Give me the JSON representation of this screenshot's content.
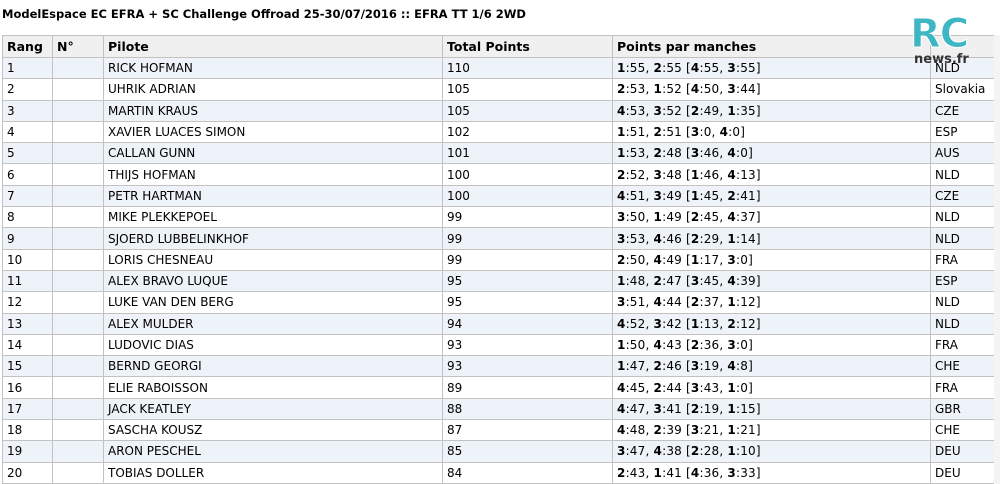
{
  "title": "ModelEspace EC EFRA + SC Challenge Offroad 25-30/07/2016 :: EFRA TT 1/6 2WD",
  "logo": {
    "main": "RC",
    "sub": "news.fr"
  },
  "headers": {
    "rang": "Rang",
    "num": "N°",
    "pilote": "Pilote",
    "total": "Total Points",
    "manches": "Points par manches",
    "country": ""
  },
  "rows": [
    {
      "rang": "1",
      "num": "",
      "pilote": "RICK HOFMAN",
      "total": "110",
      "manches": [
        "1:55",
        "2:55",
        "4:55",
        "3:55"
      ],
      "country": "NLD"
    },
    {
      "rang": "2",
      "num": "",
      "pilote": "UHRIK ADRIAN",
      "total": "105",
      "manches": [
        "2:53",
        "1:52",
        "4:50",
        "3:44"
      ],
      "country": "Slovakia"
    },
    {
      "rang": "3",
      "num": "",
      "pilote": "MARTIN KRAUS",
      "total": "105",
      "manches": [
        "4:53",
        "3:52",
        "2:49",
        "1:35"
      ],
      "country": "CZE"
    },
    {
      "rang": "4",
      "num": "",
      "pilote": "XAVIER LUACES SIMON",
      "total": "102",
      "manches": [
        "1:51",
        "2:51",
        "3:0",
        "4:0"
      ],
      "country": "ESP"
    },
    {
      "rang": "5",
      "num": "",
      "pilote": "CALLAN GUNN",
      "total": "101",
      "manches": [
        "1:53",
        "2:48",
        "3:46",
        "4:0"
      ],
      "country": "AUS"
    },
    {
      "rang": "6",
      "num": "",
      "pilote": "THIJS HOFMAN",
      "total": "100",
      "manches": [
        "2:52",
        "3:48",
        "1:46",
        "4:13"
      ],
      "country": "NLD"
    },
    {
      "rang": "7",
      "num": "",
      "pilote": "PETR HARTMAN",
      "total": "100",
      "manches": [
        "4:51",
        "3:49",
        "1:45",
        "2:41"
      ],
      "country": "CZE"
    },
    {
      "rang": "8",
      "num": "",
      "pilote": "MIKE PLEKKEPOEL",
      "total": "99",
      "manches": [
        "3:50",
        "1:49",
        "2:45",
        "4:37"
      ],
      "country": "NLD"
    },
    {
      "rang": "9",
      "num": "",
      "pilote": "SJOERD LUBBELINKHOF",
      "total": "99",
      "manches": [
        "3:53",
        "4:46",
        "2:29",
        "1:14"
      ],
      "country": "NLD"
    },
    {
      "rang": "10",
      "num": "",
      "pilote": "LORIS CHESNEAU",
      "total": "99",
      "manches": [
        "2:50",
        "4:49",
        "1:17",
        "3:0"
      ],
      "country": "FRA"
    },
    {
      "rang": "11",
      "num": "",
      "pilote": "ALEX BRAVO LUQUE",
      "total": "95",
      "manches": [
        "1:48",
        "2:47",
        "3:45",
        "4:39"
      ],
      "country": "ESP"
    },
    {
      "rang": "12",
      "num": "",
      "pilote": "LUKE VAN DEN BERG",
      "total": "95",
      "manches": [
        "3:51",
        "4:44",
        "2:37",
        "1:12"
      ],
      "country": "NLD"
    },
    {
      "rang": "13",
      "num": "",
      "pilote": "ALEX MULDER",
      "total": "94",
      "manches": [
        "4:52",
        "3:42",
        "1:13",
        "2:12"
      ],
      "country": "NLD"
    },
    {
      "rang": "14",
      "num": "",
      "pilote": "LUDOVIC DIAS",
      "total": "93",
      "manches": [
        "1:50",
        "4:43",
        "2:36",
        "3:0"
      ],
      "country": "FRA"
    },
    {
      "rang": "15",
      "num": "",
      "pilote": "BERND GEORGI",
      "total": "93",
      "manches": [
        "1:47",
        "2:46",
        "3:19",
        "4:8"
      ],
      "country": "CHE"
    },
    {
      "rang": "16",
      "num": "",
      "pilote": "ELIE RABOISSON",
      "total": "89",
      "manches": [
        "4:45",
        "2:44",
        "3:43",
        "1:0"
      ],
      "country": "FRA"
    },
    {
      "rang": "17",
      "num": "",
      "pilote": "JACK KEATLEY",
      "total": "88",
      "manches": [
        "4:47",
        "3:41",
        "2:19",
        "1:15"
      ],
      "country": "GBR"
    },
    {
      "rang": "18",
      "num": "",
      "pilote": "SASCHA KOUSZ",
      "total": "87",
      "manches": [
        "4:48",
        "2:39",
        "3:21",
        "1:21"
      ],
      "country": "CHE"
    },
    {
      "rang": "19",
      "num": "",
      "pilote": "ARON PESCHEL",
      "total": "85",
      "manches": [
        "3:47",
        "4:38",
        "2:28",
        "1:10"
      ],
      "country": "DEU"
    },
    {
      "rang": "20",
      "num": "",
      "pilote": "TOBIAS DOLLER",
      "total": "84",
      "manches": [
        "2:43",
        "1:41",
        "4:36",
        "3:33"
      ],
      "country": "DEU"
    }
  ]
}
